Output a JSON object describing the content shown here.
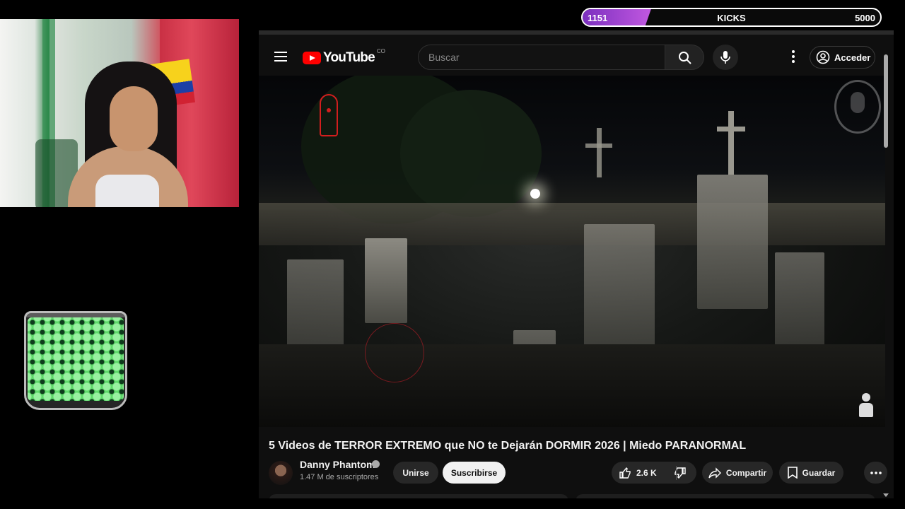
{
  "kicks": {
    "current": "1151",
    "label": "KICKS",
    "goal": "5000",
    "progress": 0.23
  },
  "youtube": {
    "logo_text": "YouTube",
    "country_code": "CO",
    "search_placeholder": "Buscar",
    "signin_label": "Acceder",
    "video": {
      "title": "5 Videos de TERROR EXTREMO que NO te Dejarán DORMIR 2026 | Miedo PARANORMAL"
    },
    "channel": {
      "name": "Danny Phantom",
      "subscribers": "1.47 M de suscriptores",
      "join_label": "Unirse",
      "subscribe_label": "Suscribirse"
    },
    "actions": {
      "likes": "2.6 K",
      "share_label": "Compartir",
      "save_label": "Guardar"
    }
  },
  "colors": {
    "accent_purple": "#a945d6",
    "youtube_red": "#ff0000",
    "background": "#0f0f0f"
  }
}
